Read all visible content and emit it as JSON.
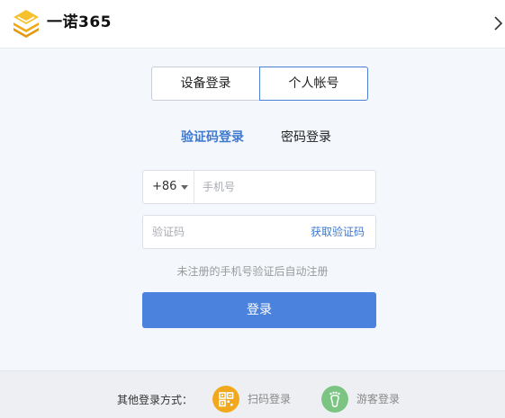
{
  "window": {
    "title": "一诺365",
    "close_icon": "chevron-right-icon"
  },
  "tabs": [
    {
      "label": "设备登录",
      "active": false
    },
    {
      "label": "个人帐号",
      "active": true
    }
  ],
  "login_modes": {
    "sms": "验证码登录",
    "password": "密码登录",
    "active": "sms"
  },
  "phone_field": {
    "country_code": "+86",
    "placeholder": "手机号",
    "value": ""
  },
  "code_field": {
    "placeholder": "验证码",
    "value": "",
    "get_code_label": "获取验证码"
  },
  "hint": "未注册的手机号验证后自动注册",
  "login_button": "登录",
  "footer": {
    "label": "其他登录方式：",
    "options": [
      {
        "label": "扫码登录",
        "icon": "qr-code-icon",
        "color": "#f2a81d"
      },
      {
        "label": "游客登录",
        "icon": "footprint-icon",
        "color": "#7bc482"
      }
    ]
  },
  "colors": {
    "accent": "#4a82de",
    "link": "#3f79cf",
    "logo": "#f2b21a",
    "background": "#f4f8fd"
  }
}
